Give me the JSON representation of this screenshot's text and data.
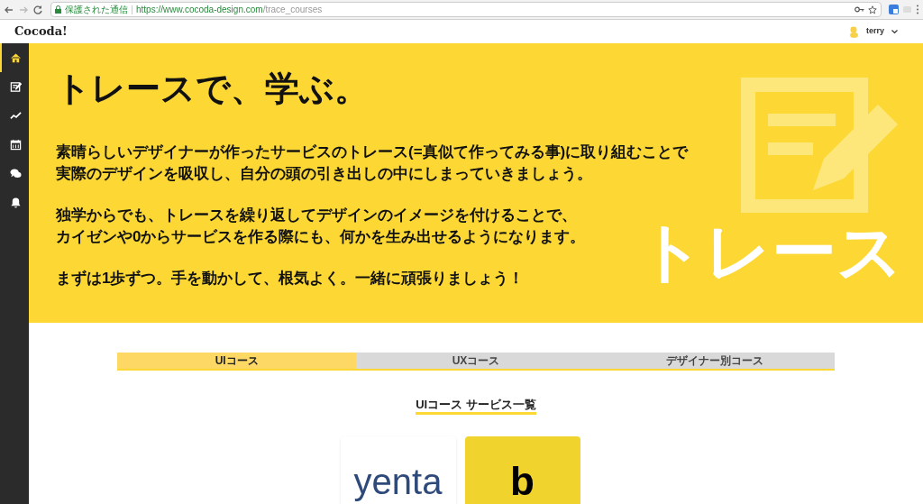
{
  "browser": {
    "secure_label": "保護された通信",
    "url_host": "https://www.cocoda-design.com",
    "url_path": "/trace_courses"
  },
  "header": {
    "logo": "Cocoda!",
    "user": "terry"
  },
  "sidebar": {
    "items": [
      {
        "kind": "home",
        "selected": true
      },
      {
        "kind": "edit",
        "selected": false
      },
      {
        "kind": "chart",
        "selected": false
      },
      {
        "kind": "calendar",
        "selected": false
      },
      {
        "kind": "chat",
        "selected": false
      },
      {
        "kind": "bell",
        "selected": false
      }
    ]
  },
  "hero": {
    "title": "トレースで、学ぶ。",
    "paragraphs": [
      [
        "素晴らしいデザイナーが作ったサービスのトレース(=真似て作ってみる事)に取り組むことで",
        "実際のデザインを吸収し、自分の頭の引き出しの中にしまっていきましょう。"
      ],
      [
        "独学からでも、トレースを繰り返してデザインのイメージを付けることで、",
        "カイゼンや0からサービスを作る際にも、何かを生み出せるようになります。"
      ],
      [
        "まずは1歩ずつ。手を動かして、根気よく。一緒に頑張りましょう！"
      ]
    ],
    "badge": "トレース"
  },
  "tabs": [
    {
      "label": "UIコース",
      "selected": true
    },
    {
      "label": "UXコース",
      "selected": false
    },
    {
      "label": "デザイナー別コース",
      "selected": false
    }
  ],
  "section_title": "UIコース サービス一覧",
  "cards": [
    {
      "logo": "yenta",
      "kind": "white"
    },
    {
      "logo": "b",
      "kind": "yellow"
    }
  ]
}
